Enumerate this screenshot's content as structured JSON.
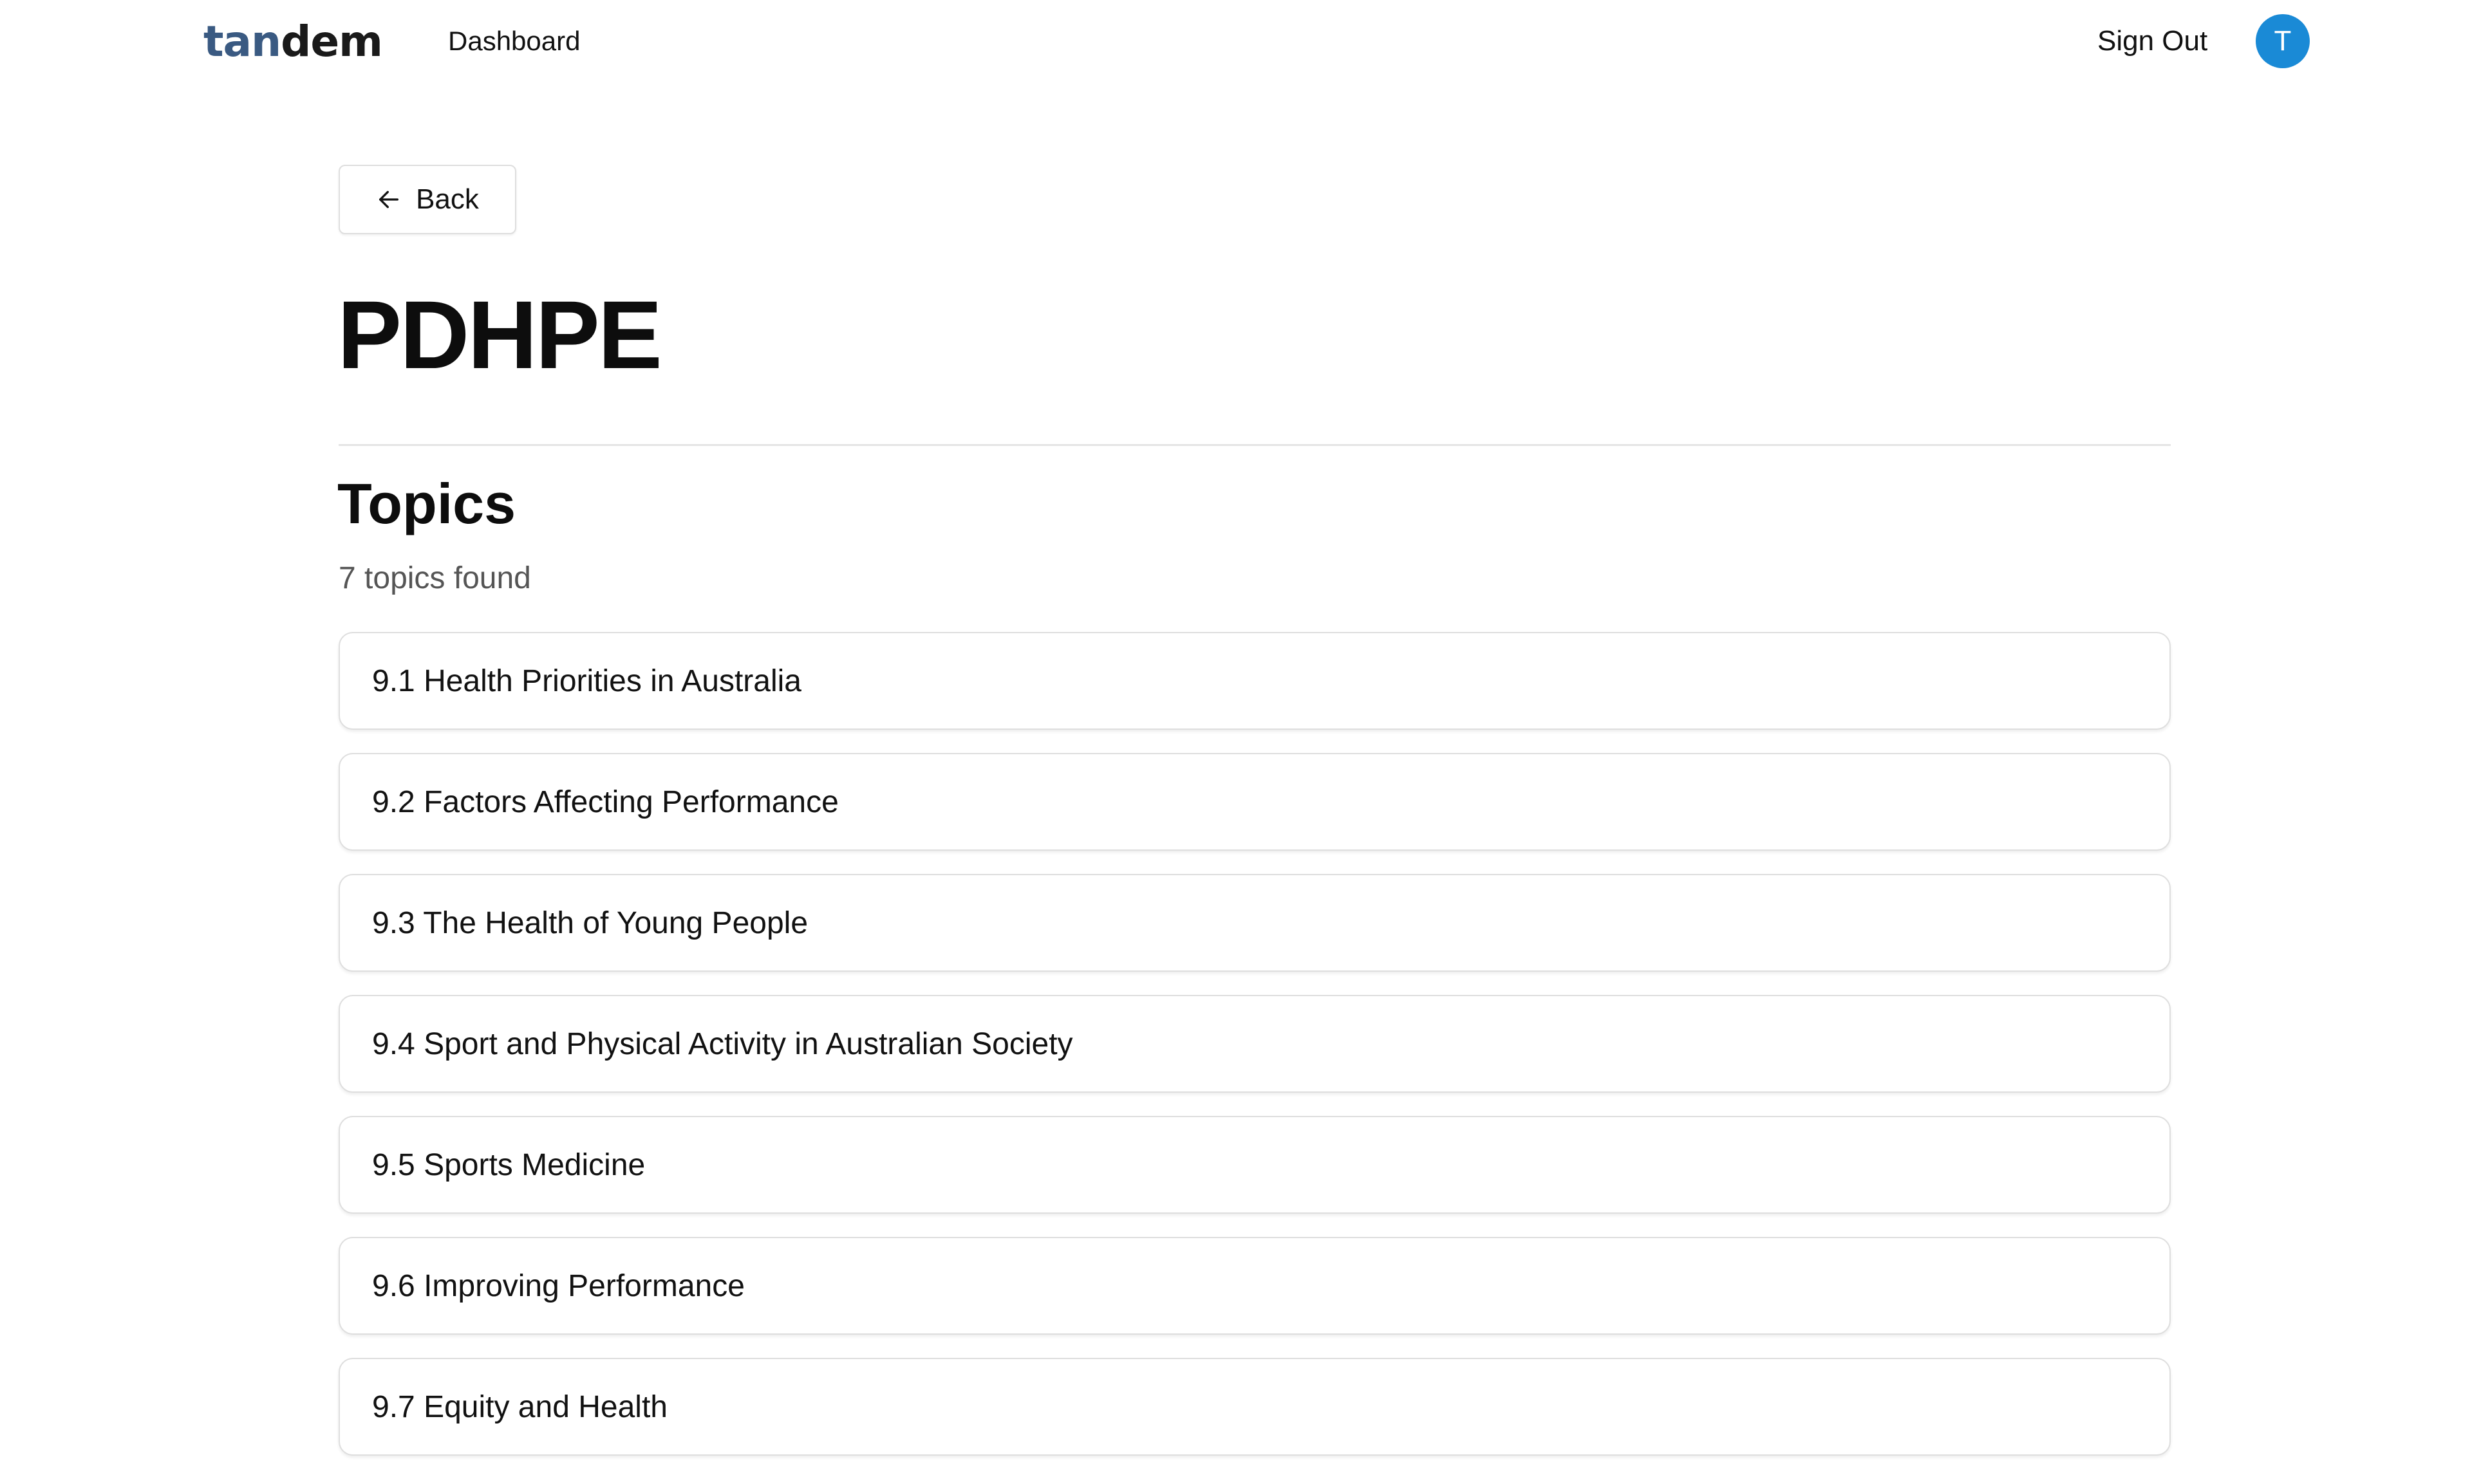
{
  "header": {
    "logo": {
      "part_a": "tan",
      "part_b": "dem"
    },
    "nav_dashboard": "Dashboard",
    "sign_out": "Sign Out",
    "avatar_initial": "T",
    "avatar_color": "#1a8ad6"
  },
  "back_button": {
    "label": "Back",
    "icon": "arrow-left-icon"
  },
  "page_title": "PDHPE",
  "topics_section": {
    "title": "Topics",
    "count_text": "7 topics found",
    "items": [
      {
        "label": "9.1 Health Priorities in Australia"
      },
      {
        "label": "9.2 Factors Affecting Performance"
      },
      {
        "label": "9.3 The Health of Young People"
      },
      {
        "label": "9.4 Sport and Physical Activity in Australian Society"
      },
      {
        "label": "9.5 Sports Medicine"
      },
      {
        "label": "9.6 Improving Performance"
      },
      {
        "label": "9.7 Equity and Health"
      }
    ]
  },
  "colors": {
    "logo_accent": "#3a5a82",
    "text_primary": "#111111",
    "text_muted": "#555555",
    "border": "#dedede"
  }
}
